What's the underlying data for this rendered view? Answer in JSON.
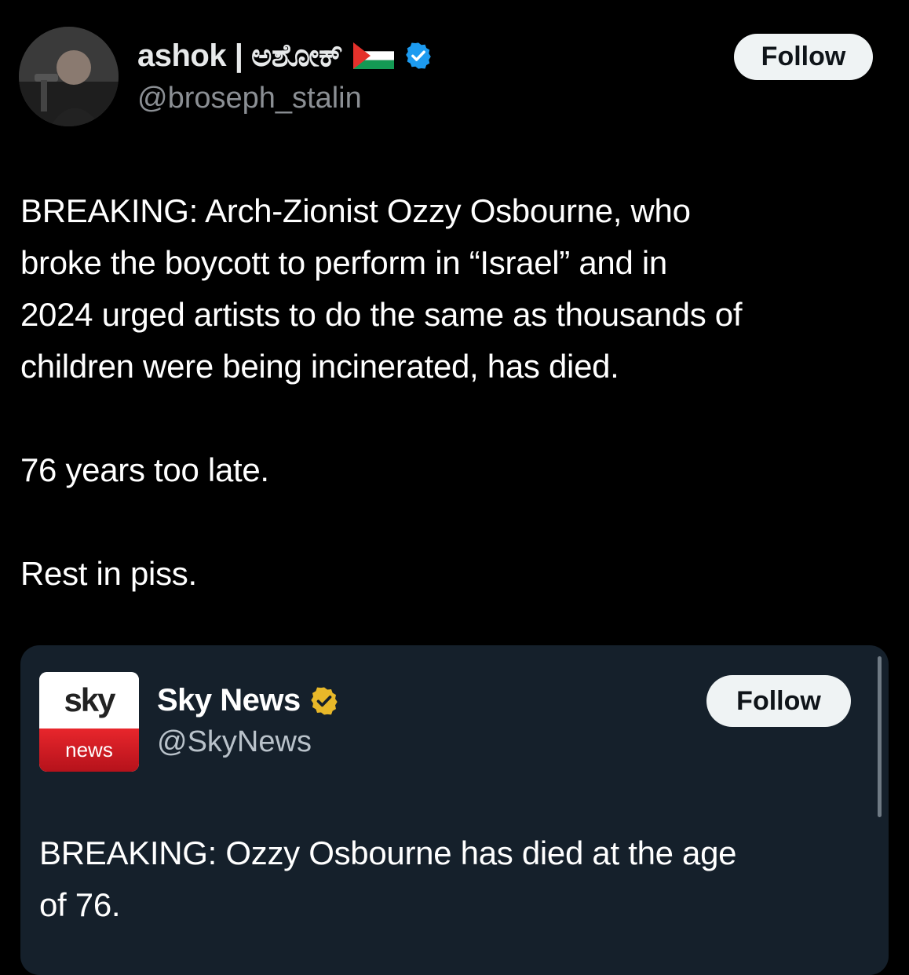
{
  "tweet": {
    "author": {
      "display_name": "ashok | ಅಶೋಕ್",
      "handle": "@broseph_stalin",
      "flag_icon": "palestine-flag-icon",
      "verified_color": "#1d9bf0"
    },
    "follow_label": "Follow",
    "paragraphs": {
      "line1": "BREAKING: Arch-Zionist Ozzy Osbourne, who",
      "line2": "broke the boycott to perform in “Israel” and in",
      "line3": "2024 urged artists to do the same as thousands of",
      "line4": "children were being incinerated, has died.",
      "line5": "76 years too late.",
      "line6": "Rest in piss."
    }
  },
  "quoted_tweet": {
    "author": {
      "display_name": "Sky News",
      "handle": "@SkyNews",
      "logo_top": "sky",
      "logo_bottom": "news",
      "verified_color": "#e8b829"
    },
    "follow_label": "Follow",
    "text": {
      "line1": "BREAKING: Ozzy Osbourne has died at the age",
      "line2": "of 76."
    }
  }
}
